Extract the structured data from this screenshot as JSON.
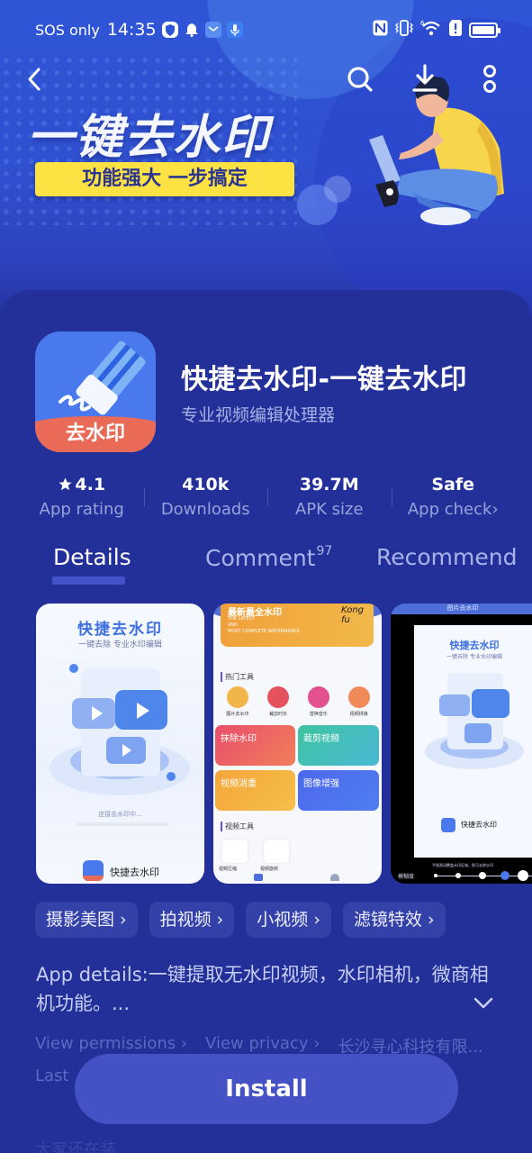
{
  "status_bar": {
    "carrier": "SOS only",
    "time": "14:35",
    "left_icons": [
      "shield-icon",
      "bell-icon",
      "mail-icon",
      "mic-icon"
    ],
    "right_icons": [
      "nfc-icon",
      "vibrate-icon",
      "wifi-6-icon",
      "sim-alert-icon",
      "battery-icon"
    ],
    "wifi_generation": "6",
    "battery_level": 1.0
  },
  "nav": {
    "back": "back-icon",
    "search": "search-icon",
    "download": "download-icon",
    "more": "more-icon"
  },
  "banner": {
    "headline": "一键去水印",
    "tagline": "功能强大 一步搞定"
  },
  "app": {
    "name": "快捷去水印-一键去水印",
    "subtitle": "专业视频编辑处理器",
    "icon_label": "去水印"
  },
  "stats": [
    {
      "value": "4.1",
      "label": "App rating",
      "icon": "star-icon"
    },
    {
      "value": "410k",
      "label": "Downloads"
    },
    {
      "value": "39.7M",
      "label": "APK size"
    },
    {
      "value": "Safe",
      "label": "App check",
      "chevron": "›"
    }
  ],
  "tabs": [
    {
      "label": "Details",
      "active": true
    },
    {
      "label": "Comment",
      "badge": "97",
      "active": false
    },
    {
      "label": "Recommend",
      "active": false
    }
  ],
  "screenshots": {
    "shot1": {
      "title": "快捷去水印",
      "subtitle": "一键去除   专业水印编辑",
      "progress_text": "连接去水印中...",
      "footer_label": "快捷去水印"
    },
    "shot2": {
      "banner_title": "最新最全水印",
      "banner_en": "THE LATEST\nAND\nMOST COMPLETE WATERMARKS",
      "banner_art": "Kong fu",
      "section1": "热门工具",
      "tools": [
        "图片去水印",
        "裁剪时长",
        "替换音乐",
        "视频拼接"
      ],
      "cards": [
        "抹除水印",
        "裁剪视频",
        "视频消重",
        "图像增强"
      ],
      "section2": "视频工具",
      "video_tools": [
        "视频压缩",
        "视频旋转"
      ]
    },
    "shot3": {
      "header": "图片去水印",
      "title": "快捷去水印",
      "subtitle": "一键去除   专业水印编辑",
      "footer_label": "快捷去水印",
      "hint": "手指滑动覆盖水印区域，即可去除水印",
      "slider_label": "模糊度",
      "slider_steps": 5,
      "slider_selected": 4
    }
  },
  "tags": [
    "摄影美图 ›",
    "拍视频 ›",
    "小视频 ›",
    "滤镜特效 ›"
  ],
  "description": "App details:一键提取无水印视频，水印相机，微商相机功能。...",
  "links": {
    "permissions": "View permissions ›",
    "privacy": "View privacy ›",
    "developer": "长沙寻心科技有限...",
    "last_updated_prefix": "Last",
    "next_section": "大家还在装"
  },
  "install_button": "Install",
  "colors": {
    "background": "#23309a",
    "banner_blue": "#2f55d6",
    "tagline_yellow": "#fde243",
    "install_button": "#4452c6",
    "tab_indicator": "#4252c8",
    "icon_blue": "#4a79ee",
    "icon_red": "#ea6a58"
  }
}
